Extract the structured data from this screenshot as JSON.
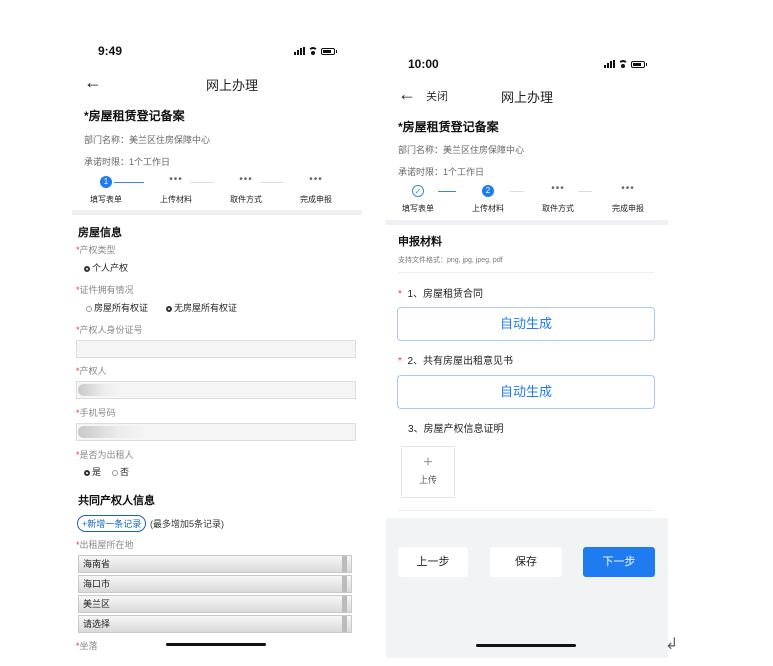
{
  "left": {
    "status": {
      "time": "9:49"
    },
    "nav": {
      "back": "←",
      "title": "网上办理"
    },
    "header": {
      "title": "*房屋租赁登记备案",
      "dept": "部门名称：美兰区住房保障中心",
      "deadline": "承诺时限：1个工作日"
    },
    "steps": [
      {
        "label": "填写表单",
        "marker": "1",
        "state": "active"
      },
      {
        "label": "上传材料",
        "marker": "•••",
        "state": "pending"
      },
      {
        "label": "取件方式",
        "marker": "•••",
        "state": "pending"
      },
      {
        "label": "完成申报",
        "marker": "•••",
        "state": "pending"
      }
    ],
    "house": {
      "section": "房屋信息",
      "type_label": "产权类型",
      "type_value": "个人产权",
      "cert_label": "证件拥有情况",
      "cert_opt1": "房屋所有权证",
      "cert_opt2": "无房屋所有权证",
      "id_label": "产权人身份证号",
      "owner_label": "产权人",
      "phone_label": "手机号码",
      "lessor_label": "是否为出租人",
      "lessor_yes": "是",
      "lessor_no": "否"
    },
    "co_owner": {
      "section": "共同产权人信息",
      "add_label": "+新增一条记录",
      "add_note": "(最多增加5条记录)",
      "loc_label": "出租屋所在地",
      "province": "海南省",
      "city": "海口市",
      "district": "美兰区",
      "choose": "请选择",
      "addr_label": "坐落"
    },
    "required_mark": "*"
  },
  "right": {
    "status": {
      "time": "10:00"
    },
    "nav": {
      "back": "←",
      "close": "关闭",
      "title": "网上办理"
    },
    "header": {
      "title": "*房屋租赁登记备案",
      "dept": "部门名称：美兰区住房保障中心",
      "deadline": "承诺时限：1个工作日"
    },
    "steps": [
      {
        "label": "填写表单",
        "marker": "✓",
        "state": "done"
      },
      {
        "label": "上传材料",
        "marker": "2",
        "state": "active"
      },
      {
        "label": "取件方式",
        "marker": "•••",
        "state": "pending"
      },
      {
        "label": "完成申报",
        "marker": "•••",
        "state": "pending"
      }
    ],
    "materials": {
      "section": "申报材料",
      "hint": "支持文件格式：png, jpg, jpeg, pdf",
      "item1": "1、房屋租赁合同",
      "auto1": "自动生成",
      "item2": "2、共有房屋出租意见书",
      "auto2": "自动生成",
      "item3": "3、房屋产权信息证明",
      "upload_plus": "+",
      "upload_label": "上传"
    },
    "footer": {
      "prev": "上一步",
      "save": "保存",
      "next": "下一步"
    },
    "required_mark": "*"
  },
  "enter_icon": "return-arrow-icon",
  "colors": {
    "accent": "#1e7bf0",
    "required": "#e53935",
    "link": "#1565c0"
  }
}
